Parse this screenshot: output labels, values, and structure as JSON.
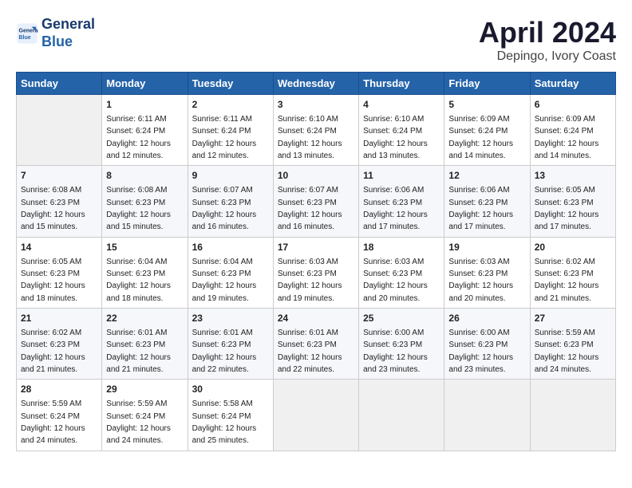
{
  "header": {
    "logo_line1": "General",
    "logo_line2": "Blue",
    "month": "April 2024",
    "location": "Depingo, Ivory Coast"
  },
  "weekdays": [
    "Sunday",
    "Monday",
    "Tuesday",
    "Wednesday",
    "Thursday",
    "Friday",
    "Saturday"
  ],
  "weeks": [
    [
      {
        "day": "",
        "detail": ""
      },
      {
        "day": "1",
        "detail": "Sunrise: 6:11 AM\nSunset: 6:24 PM\nDaylight: 12 hours\nand 12 minutes."
      },
      {
        "day": "2",
        "detail": "Sunrise: 6:11 AM\nSunset: 6:24 PM\nDaylight: 12 hours\nand 12 minutes."
      },
      {
        "day": "3",
        "detail": "Sunrise: 6:10 AM\nSunset: 6:24 PM\nDaylight: 12 hours\nand 13 minutes."
      },
      {
        "day": "4",
        "detail": "Sunrise: 6:10 AM\nSunset: 6:24 PM\nDaylight: 12 hours\nand 13 minutes."
      },
      {
        "day": "5",
        "detail": "Sunrise: 6:09 AM\nSunset: 6:24 PM\nDaylight: 12 hours\nand 14 minutes."
      },
      {
        "day": "6",
        "detail": "Sunrise: 6:09 AM\nSunset: 6:24 PM\nDaylight: 12 hours\nand 14 minutes."
      }
    ],
    [
      {
        "day": "7",
        "detail": "Sunrise: 6:08 AM\nSunset: 6:23 PM\nDaylight: 12 hours\nand 15 minutes."
      },
      {
        "day": "8",
        "detail": "Sunrise: 6:08 AM\nSunset: 6:23 PM\nDaylight: 12 hours\nand 15 minutes."
      },
      {
        "day": "9",
        "detail": "Sunrise: 6:07 AM\nSunset: 6:23 PM\nDaylight: 12 hours\nand 16 minutes."
      },
      {
        "day": "10",
        "detail": "Sunrise: 6:07 AM\nSunset: 6:23 PM\nDaylight: 12 hours\nand 16 minutes."
      },
      {
        "day": "11",
        "detail": "Sunrise: 6:06 AM\nSunset: 6:23 PM\nDaylight: 12 hours\nand 17 minutes."
      },
      {
        "day": "12",
        "detail": "Sunrise: 6:06 AM\nSunset: 6:23 PM\nDaylight: 12 hours\nand 17 minutes."
      },
      {
        "day": "13",
        "detail": "Sunrise: 6:05 AM\nSunset: 6:23 PM\nDaylight: 12 hours\nand 17 minutes."
      }
    ],
    [
      {
        "day": "14",
        "detail": "Sunrise: 6:05 AM\nSunset: 6:23 PM\nDaylight: 12 hours\nand 18 minutes."
      },
      {
        "day": "15",
        "detail": "Sunrise: 6:04 AM\nSunset: 6:23 PM\nDaylight: 12 hours\nand 18 minutes."
      },
      {
        "day": "16",
        "detail": "Sunrise: 6:04 AM\nSunset: 6:23 PM\nDaylight: 12 hours\nand 19 minutes."
      },
      {
        "day": "17",
        "detail": "Sunrise: 6:03 AM\nSunset: 6:23 PM\nDaylight: 12 hours\nand 19 minutes."
      },
      {
        "day": "18",
        "detail": "Sunrise: 6:03 AM\nSunset: 6:23 PM\nDaylight: 12 hours\nand 20 minutes."
      },
      {
        "day": "19",
        "detail": "Sunrise: 6:03 AM\nSunset: 6:23 PM\nDaylight: 12 hours\nand 20 minutes."
      },
      {
        "day": "20",
        "detail": "Sunrise: 6:02 AM\nSunset: 6:23 PM\nDaylight: 12 hours\nand 21 minutes."
      }
    ],
    [
      {
        "day": "21",
        "detail": "Sunrise: 6:02 AM\nSunset: 6:23 PM\nDaylight: 12 hours\nand 21 minutes."
      },
      {
        "day": "22",
        "detail": "Sunrise: 6:01 AM\nSunset: 6:23 PM\nDaylight: 12 hours\nand 21 minutes."
      },
      {
        "day": "23",
        "detail": "Sunrise: 6:01 AM\nSunset: 6:23 PM\nDaylight: 12 hours\nand 22 minutes."
      },
      {
        "day": "24",
        "detail": "Sunrise: 6:01 AM\nSunset: 6:23 PM\nDaylight: 12 hours\nand 22 minutes."
      },
      {
        "day": "25",
        "detail": "Sunrise: 6:00 AM\nSunset: 6:23 PM\nDaylight: 12 hours\nand 23 minutes."
      },
      {
        "day": "26",
        "detail": "Sunrise: 6:00 AM\nSunset: 6:23 PM\nDaylight: 12 hours\nand 23 minutes."
      },
      {
        "day": "27",
        "detail": "Sunrise: 5:59 AM\nSunset: 6:23 PM\nDaylight: 12 hours\nand 24 minutes."
      }
    ],
    [
      {
        "day": "28",
        "detail": "Sunrise: 5:59 AM\nSunset: 6:24 PM\nDaylight: 12 hours\nand 24 minutes."
      },
      {
        "day": "29",
        "detail": "Sunrise: 5:59 AM\nSunset: 6:24 PM\nDaylight: 12 hours\nand 24 minutes."
      },
      {
        "day": "30",
        "detail": "Sunrise: 5:58 AM\nSunset: 6:24 PM\nDaylight: 12 hours\nand 25 minutes."
      },
      {
        "day": "",
        "detail": ""
      },
      {
        "day": "",
        "detail": ""
      },
      {
        "day": "",
        "detail": ""
      },
      {
        "day": "",
        "detail": ""
      }
    ]
  ]
}
